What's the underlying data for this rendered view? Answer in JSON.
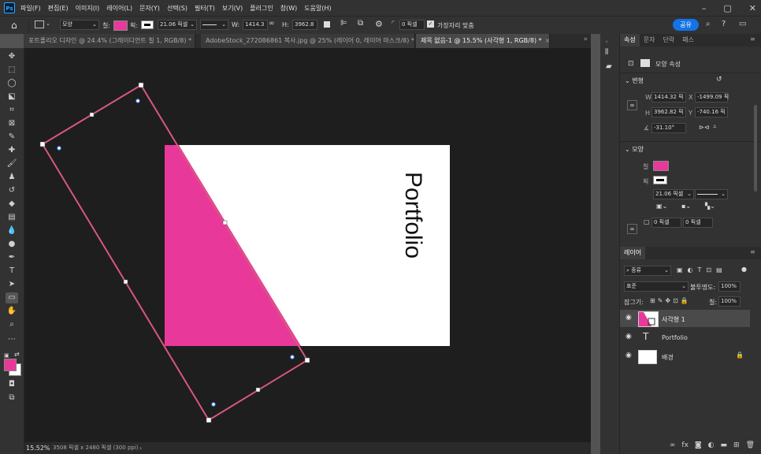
{
  "app": {
    "logo": "Ps"
  },
  "menu": [
    "파일(F)",
    "편집(E)",
    "이미지(I)",
    "레이어(L)",
    "문자(Y)",
    "선택(S)",
    "필터(T)",
    "보기(V)",
    "플러그인",
    "창(W)",
    "도움말(H)"
  ],
  "options": {
    "shape_mode": "모양",
    "fill_label": "칠:",
    "stroke_label": "획:",
    "stroke_width": "21.06 픽셀",
    "w_label": "W:",
    "w_value": "1414.3",
    "h_label": "H:",
    "h_value": "3962.8",
    "corner_value": "0 픽셀",
    "align_edges_label": "가장자리 맞춤",
    "share_label": "공유",
    "fill_color": "#e8399a"
  },
  "doc_tabs": [
    {
      "label": "포트폴리오 디자인 @ 24.4% (그레이디언트 칠 1, RGB/8) *",
      "close": "×"
    },
    {
      "label": "AdobeStock_272086861 복사.jpg @ 25% (레이어 0, 레이어 마스크/8) *",
      "close": "×"
    },
    {
      "label": "제목 없음-1 @ 15.5% (사각형 1, RGB/8) *",
      "close": "×"
    }
  ],
  "canvas": {
    "portfolio_text": "Portfolio",
    "pink_color": "#e8399a",
    "path_color": "#d8577f"
  },
  "status": {
    "zoom": "15.52%",
    "doc_info": "3508 픽셀 x 2480 픽셀 (300 ppi)",
    "arrow": "›"
  },
  "properties": {
    "tabs": [
      "속성",
      "문자",
      "단락",
      "패스"
    ],
    "kind_label": "모양 속성",
    "transform_title": "변형",
    "w_label": "W",
    "w_value": "1414.32 픽",
    "x_label": "X",
    "x_value": "-1499.09 픽",
    "h_label": "H",
    "h_value": "3962.82 픽",
    "y_label": "Y",
    "y_value": "-740.16 픽",
    "angle_value": "-31.10°",
    "appearance_title": "모양",
    "fill_label": "칠",
    "stroke_label": "획",
    "stroke_width": "21.06 픽셀",
    "corner1": "0 픽셀",
    "corner2": "0 픽셀"
  },
  "layers": {
    "tab": "레이어",
    "filter_label": "종류",
    "blend_mode": "표준",
    "opacity_label": "불투명도:",
    "opacity_value": "100%",
    "lock_label": "잠그기:",
    "fill_label": "칠:",
    "fill_value": "100%",
    "items": [
      {
        "name": "사각형 1"
      },
      {
        "name": "Portfolio",
        "icon": "T"
      },
      {
        "name": "배경"
      }
    ]
  }
}
